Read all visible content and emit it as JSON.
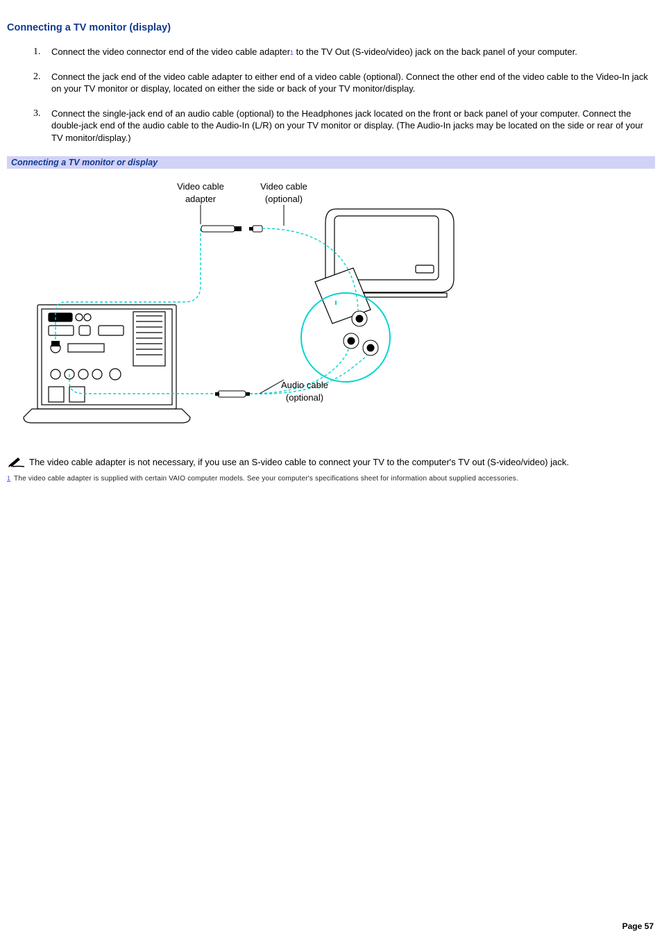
{
  "section": {
    "title": "Connecting a TV monitor (display)"
  },
  "steps": [
    {
      "text_before_ref": "Connect the video connector end of the video cable adapter",
      "ref": "1",
      "text_after_ref": " to the TV Out (S-video/video) jack on the back panel of your computer."
    },
    {
      "text_before_ref": "Connect the jack end of the video cable adapter to either end of a video cable (optional). Connect the other end of the video cable to the Video-In jack on your TV monitor or display, located on either the side or back of your TV monitor/display.",
      "ref": "",
      "text_after_ref": ""
    },
    {
      "text_before_ref": "Connect the single-jack end of an audio cable (optional) to the Headphones jack located on the front or back panel of your computer. Connect the double-jack end of the audio cable to the Audio-In (L/R) on your TV monitor or display. (The Audio-In jacks may be located on the side or rear of your TV monitor/display.)",
      "ref": "",
      "text_after_ref": ""
    }
  ],
  "figure": {
    "caption": "Connecting a TV monitor or display",
    "labels": {
      "video_cable_adapter_l1": "Video cable",
      "video_cable_adapter_l2": "adapter",
      "video_cable_optional_l1": "Video cable",
      "video_cable_optional_l2": "(optional)",
      "audio_cable_l1": "Audio cable",
      "audio_cable_l2": "(optional)"
    }
  },
  "note": {
    "text": "The video cable adapter is not necessary, if you use an S-video cable to connect your TV to the computer's TV out (S-video/video) jack."
  },
  "footnote": {
    "ref": "1",
    "text": " The video cable adapter is supplied with certain VAIO computer models. See your computer's specifications sheet for information about supplied accessories."
  },
  "page_number": "Page 57"
}
